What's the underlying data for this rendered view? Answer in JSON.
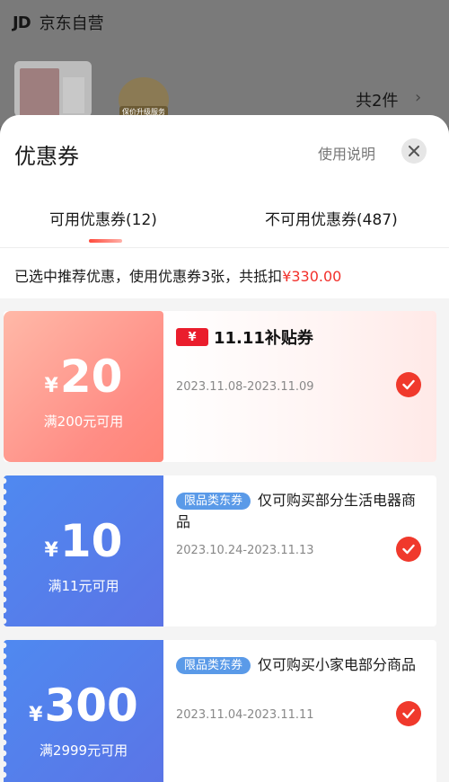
{
  "background": {
    "jd_logo": "JD",
    "shop_name": "京东自营",
    "badge_label": "保价升级服务",
    "item_count": "共2件",
    "chevron": "›"
  },
  "sheet": {
    "title": "优惠券",
    "help_link": "使用说明",
    "close_icon": "close-icon"
  },
  "tabs": [
    {
      "label": "可用优惠券(12)",
      "active": true
    },
    {
      "label": "不可用优惠券(487)",
      "active": false
    }
  ],
  "summary": {
    "text": "已选中推荐优惠，使用优惠券3张，共抵扣",
    "amount": "¥330.00"
  },
  "coupons": [
    {
      "currency": "¥",
      "value": "20",
      "condition": "满200元可用",
      "brand_badge": "¥",
      "brand_text": "11.11补贴券",
      "validity": "2023.11.08-2023.11.09",
      "selected": true
    },
    {
      "currency": "¥",
      "value": "10",
      "condition": "满11元可用",
      "tag": "限品类东券",
      "description": "仅可购买部分生活电器商品",
      "validity": "2023.10.24-2023.11.13",
      "selected": true
    },
    {
      "currency": "¥",
      "value": "300",
      "condition": "满2999元可用",
      "tag": "限品类东券",
      "description": "仅可购买小家电部分商品",
      "validity": "2023.11.04-2023.11.11",
      "selected": true
    }
  ],
  "colors": {
    "accent_red": "#f2302b",
    "coupon_blue": "#5b7fea",
    "coupon_pink": "#ff8d85",
    "tag_blue": "#5a9ae8"
  }
}
